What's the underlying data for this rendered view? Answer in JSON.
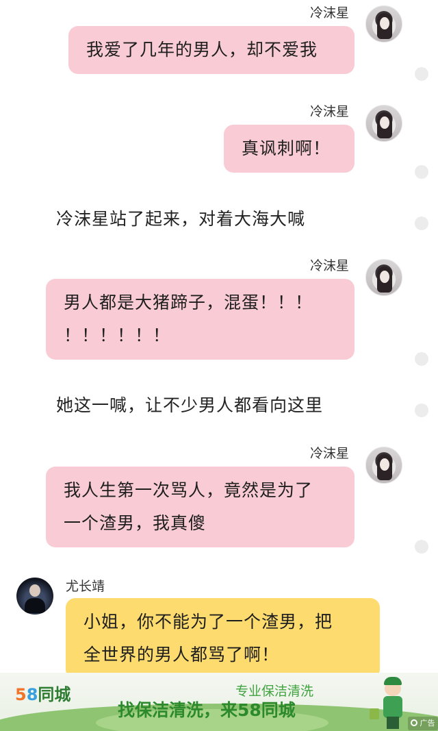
{
  "messages": [
    {
      "speaker": "冷沫星",
      "lines": [
        "我爱了几年的男人，却不爱我"
      ]
    },
    {
      "speaker": "冷沫星",
      "lines": [
        "真讽刺啊！"
      ]
    },
    {
      "narration": "冷沫星站了起来，对着大海大喊"
    },
    {
      "speaker": "冷沫星",
      "lines": [
        "男人都是大猪蹄子，混蛋！！！",
        "！！！！！！"
      ]
    },
    {
      "narration": "她这一喊，让不少男人都看向这里"
    },
    {
      "speaker": "冷沫星",
      "lines": [
        "我人生第一次骂人，竟然是为了",
        "一个渣男，我真傻"
      ]
    },
    {
      "speaker": "尤长靖",
      "lines": [
        "小姐，你不能为了一个渣男，把",
        "全世界的男人都骂了啊！"
      ]
    }
  ],
  "ad": {
    "logo_number": "58",
    "logo_text": "同城",
    "line1": "专业保洁清洗",
    "line2": "找保洁清洗，来58同城",
    "tag": "广告"
  },
  "colors": {
    "right_bubble": "#f9ccd5",
    "left_bubble": "#fddb6e",
    "ad_green": "#2c8a2c"
  }
}
